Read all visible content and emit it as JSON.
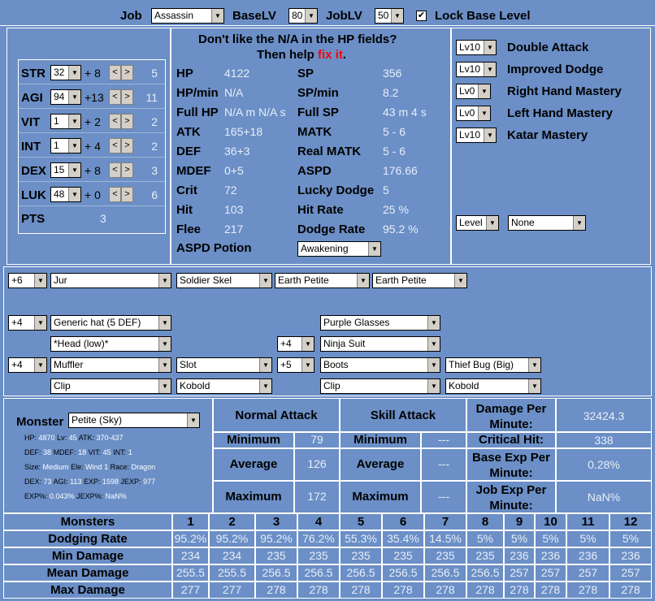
{
  "top": {
    "job_label": "Job",
    "job_value": "Assassin",
    "baselv_label": "BaseLV",
    "baselv_value": "80",
    "joblv_label": "JobLV",
    "joblv_value": "50",
    "lock_label": "Lock Base Level",
    "lock_checked": "✔"
  },
  "stats": [
    {
      "name": "STR",
      "value": "32",
      "bonus": "+ 8",
      "cost": "5"
    },
    {
      "name": "AGI",
      "value": "94",
      "bonus": "+13",
      "cost": "11"
    },
    {
      "name": "VIT",
      "value": "1",
      "bonus": "+ 2",
      "cost": "2"
    },
    {
      "name": "INT",
      "value": "1",
      "bonus": "+ 4",
      "cost": "2"
    },
    {
      "name": "DEX",
      "value": "15",
      "bonus": "+ 8",
      "cost": "3"
    },
    {
      "name": "LUK",
      "value": "48",
      "bonus": "+ 0",
      "cost": "6"
    }
  ],
  "pts": {
    "label": "PTS",
    "value": "3"
  },
  "notice": {
    "line1": "Don't like the N/A in the HP fields?",
    "line2": "Then help ",
    "link": "fix it",
    "end": "."
  },
  "derived_left": [
    {
      "label": "HP",
      "value": "4122"
    },
    {
      "label": "HP/min",
      "value": "N/A"
    },
    {
      "label": "Full HP",
      "value": "N/A m N/A s"
    },
    {
      "label": "ATK",
      "value": "165+18"
    },
    {
      "label": "DEF",
      "value": "36+3"
    },
    {
      "label": "MDEF",
      "value": "0+5"
    },
    {
      "label": "Crit",
      "value": "72"
    },
    {
      "label": "Hit",
      "value": "103"
    },
    {
      "label": "Flee",
      "value": "217"
    }
  ],
  "derived_right": [
    {
      "label": "SP",
      "value": "356"
    },
    {
      "label": "SP/min",
      "value": "8.2"
    },
    {
      "label": "Full SP",
      "value": "43 m 4 s"
    },
    {
      "label": "MATK",
      "value": "5 - 6"
    },
    {
      "label": "Real MATK",
      "value": "5 - 6"
    },
    {
      "label": "ASPD",
      "value": "176.66"
    },
    {
      "label": "Lucky Dodge",
      "value": "5"
    },
    {
      "label": "Hit Rate",
      "value": "25 %"
    },
    {
      "label": "Dodge Rate",
      "value": "95.2 %"
    }
  ],
  "aspd_potion": {
    "label": "ASPD Potion",
    "value": "Awakening"
  },
  "skills": [
    {
      "level": "Lv10",
      "name": "Double Attack"
    },
    {
      "level": "Lv10",
      "name": "Improved Dodge"
    },
    {
      "level": "Lv0",
      "name": "Right Hand Mastery"
    },
    {
      "level": "Lv0",
      "name": "Left Hand Mastery"
    },
    {
      "level": "Lv10",
      "name": "Katar Mastery"
    }
  ],
  "buff": {
    "level": "Level",
    "name": "None"
  },
  "equip": {
    "weapon_refine": "+6",
    "weapon": "Jur",
    "card1": "Soldier Skel",
    "card2": "Earth Petite",
    "card3": "Earth Petite",
    "hat_refine": "+4",
    "hat": "Generic hat (5 DEF)",
    "mid": "Purple Glasses",
    "low": "*Head (low)*",
    "armor_refine": "+4",
    "armor": "Ninja Suit",
    "garment_refine": "+4",
    "garment": "Muffler",
    "garment_card": "Slot",
    "shoes_refine": "+5",
    "shoes": "Boots",
    "shoes_card": "Thief Bug (Big)",
    "acc1": "Clip",
    "acc1_card": "Kobold",
    "acc2": "Clip",
    "acc2_card": "Kobold"
  },
  "monster": {
    "label": "Monster",
    "value": "Petite (Sky)",
    "info": [
      [
        [
          "HP:",
          "4870"
        ],
        [
          "Lv:",
          "45"
        ],
        [
          "ATK:",
          "370-437"
        ]
      ],
      [
        [
          "DEF:",
          "38"
        ],
        [
          "MDEF:",
          "18"
        ],
        [
          "VIT:",
          "45"
        ],
        [
          "INT:",
          "1"
        ]
      ],
      [
        [
          "Size:",
          "Medium"
        ],
        [
          "Ele:",
          "Wind 1"
        ],
        [
          "Race:",
          "Dragon"
        ]
      ],
      [
        [
          "DEX:",
          "73"
        ],
        [
          "AGI:",
          "113"
        ],
        [
          "EXP:",
          "1598"
        ],
        [
          "JEXP:",
          "977"
        ]
      ],
      [
        [
          "EXP%:",
          "0.043%"
        ],
        [
          "JEXP%:",
          "NaN%"
        ]
      ]
    ]
  },
  "damage": {
    "normal_header": "Normal Attack",
    "skill_header": "Skill Attack",
    "rows": [
      {
        "label": "Minimum",
        "normal": "79",
        "skill": "---"
      },
      {
        "label": "Average",
        "normal": "126",
        "skill": "---"
      },
      {
        "label": "Maximum",
        "normal": "172",
        "skill": "---"
      }
    ],
    "dpm_label": "Damage Per Minute:",
    "dpm_value": "32424.3",
    "crit_label": "Critical Hit:",
    "crit_value": "338",
    "bexp_label": "Base Exp Per Minute:",
    "bexp_value": "0.28%",
    "jexp_label": "Job Exp Per Minute:",
    "jexp_value": "NaN%"
  },
  "table": {
    "headers": [
      "Monsters",
      "1",
      "2",
      "3",
      "4",
      "5",
      "6",
      "7",
      "8",
      "9",
      "10",
      "11",
      "12"
    ],
    "rows": [
      {
        "label": "Dodging Rate",
        "values": [
          "95.2%",
          "95.2%",
          "95.2%",
          "76.2%",
          "55.3%",
          "35.4%",
          "14.5%",
          "5%",
          "5%",
          "5%",
          "5%",
          "5%"
        ]
      },
      {
        "label": "Min Damage",
        "values": [
          "234",
          "234",
          "235",
          "235",
          "235",
          "235",
          "235",
          "235",
          "236",
          "236",
          "236",
          "236"
        ]
      },
      {
        "label": "Mean Damage",
        "values": [
          "255.5",
          "255.5",
          "256.5",
          "256.5",
          "256.5",
          "256.5",
          "256.5",
          "256.5",
          "257",
          "257",
          "257",
          "257"
        ]
      },
      {
        "label": "Max Damage",
        "values": [
          "277",
          "277",
          "278",
          "278",
          "278",
          "278",
          "278",
          "278",
          "278",
          "278",
          "278",
          "278"
        ]
      }
    ]
  }
}
